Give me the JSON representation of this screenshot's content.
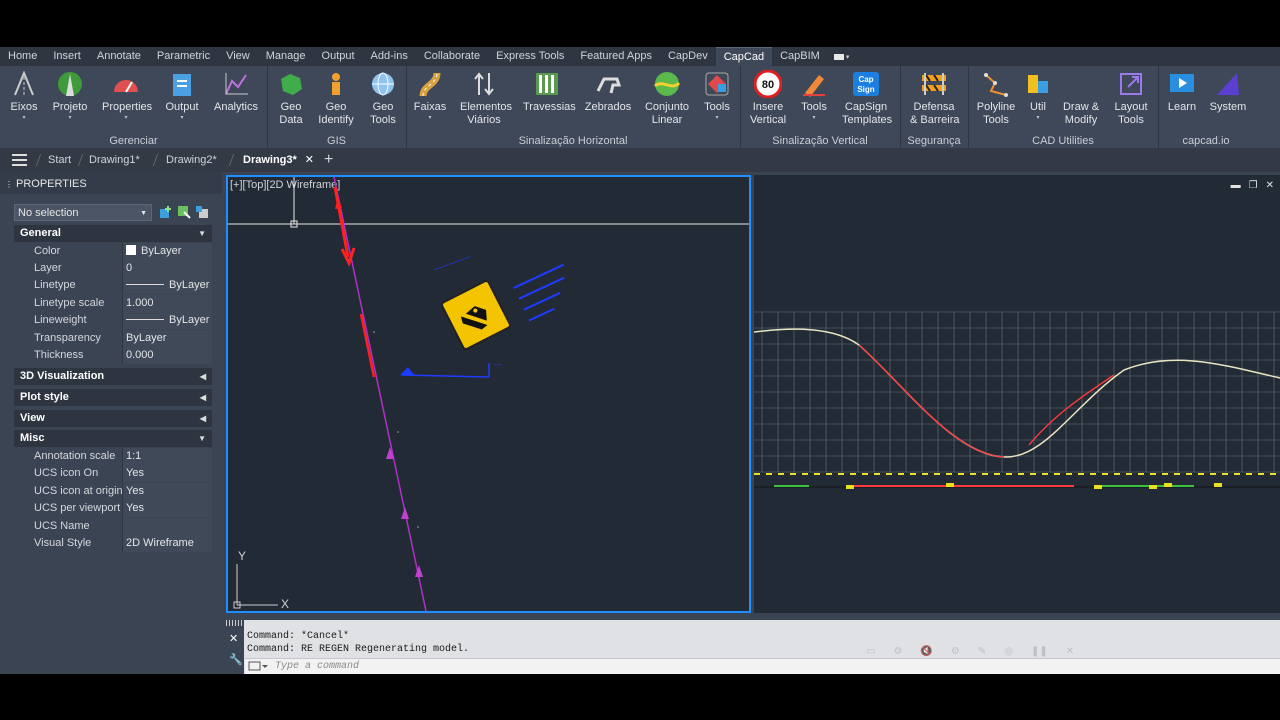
{
  "ribbon_tabs": [
    "Home",
    "Insert",
    "Annotate",
    "Parametric",
    "View",
    "Manage",
    "Output",
    "Add-ins",
    "Collaborate",
    "Express Tools",
    "Featured Apps",
    "CapDev",
    "CapCad",
    "CapBIM"
  ],
  "active_tab": "CapCad",
  "panels": {
    "gerenciar": {
      "title": "Gerenciar",
      "tools": [
        {
          "l1": "Eixos",
          "l2": ""
        },
        {
          "l1": "Projeto",
          "l2": ""
        },
        {
          "l1": "Properties",
          "l2": ""
        },
        {
          "l1": "Output",
          "l2": ""
        },
        {
          "l1": "Analytics",
          "l2": ""
        }
      ]
    },
    "gis": {
      "title": "GIS",
      "tools": [
        {
          "l1": "Geo",
          "l2": "Data"
        },
        {
          "l1": "Geo",
          "l2": "Identify"
        },
        {
          "l1": "Geo",
          "l2": "Tools"
        }
      ]
    },
    "sinal_h": {
      "title": "Sinalização Horizontal",
      "tools": [
        {
          "l1": "Faixas",
          "l2": ""
        },
        {
          "l1": "Elementos",
          "l2": "Viários"
        },
        {
          "l1": "Travessias",
          "l2": ""
        },
        {
          "l1": "Zebrados",
          "l2": ""
        },
        {
          "l1": "Conjunto",
          "l2": "Linear"
        },
        {
          "l1": "Tools",
          "l2": ""
        }
      ]
    },
    "sinal_v": {
      "title": "Sinalização Vertical",
      "tools": [
        {
          "l1": "Insere",
          "l2": "Vertical"
        },
        {
          "l1": "Tools",
          "l2": ""
        },
        {
          "l1": "CapSign",
          "l2": "Templates"
        }
      ],
      "speed": "80",
      "capsign": "Cap Sign"
    },
    "seguranca": {
      "title": "Segurança",
      "tools": [
        {
          "l1": "Defensa",
          "l2": "& Barreira"
        }
      ]
    },
    "cad": {
      "title": "CAD Utilities",
      "tools": [
        {
          "l1": "Polyline",
          "l2": "Tools"
        },
        {
          "l1": "Util",
          "l2": ""
        },
        {
          "l1": "Draw &",
          "l2": "Modify"
        },
        {
          "l1": "Layout",
          "l2": "Tools"
        }
      ]
    },
    "capcadio": {
      "title": "capcad.io",
      "tools": [
        {
          "l1": "Learn",
          "l2": ""
        },
        {
          "l1": "System",
          "l2": ""
        }
      ]
    }
  },
  "file_tabs": {
    "start": "Start",
    "d1": "Drawing1*",
    "d2": "Drawing2*",
    "d3": "Drawing3*",
    "close": "✕",
    "add": "+"
  },
  "properties": {
    "title": "PROPERTIES",
    "selection": "No selection",
    "groups": {
      "general": "General",
      "viz": "3D Visualization",
      "plot": "Plot style",
      "view": "View",
      "misc": "Misc"
    },
    "general_rows": [
      {
        "k": "Color",
        "v": "ByLayer"
      },
      {
        "k": "Layer",
        "v": "0"
      },
      {
        "k": "Linetype",
        "v": "ByLayer"
      },
      {
        "k": "Linetype scale",
        "v": "1.000"
      },
      {
        "k": "Lineweight",
        "v": "ByLayer"
      },
      {
        "k": "Transparency",
        "v": "ByLayer"
      },
      {
        "k": "Thickness",
        "v": "0.000"
      }
    ],
    "misc_rows": [
      {
        "k": "Annotation scale",
        "v": "1:1"
      },
      {
        "k": "UCS icon On",
        "v": "Yes"
      },
      {
        "k": "UCS icon at origin",
        "v": "Yes"
      },
      {
        "k": "UCS per viewport",
        "v": "Yes"
      },
      {
        "k": "UCS Name",
        "v": ""
      },
      {
        "k": "Visual Style",
        "v": "2D Wireframe"
      }
    ]
  },
  "viewport": {
    "label": "[+][Top][2D Wireframe]",
    "ucs_x": "X",
    "ucs_y": "Y"
  },
  "command": {
    "line1": "Command: *Cancel*",
    "line2": "Command: RE REGEN Regenerating model.",
    "placeholder": "Type a command"
  },
  "colors": {
    "accent": "#1f8fff",
    "road": "#b030c8",
    "highlight": "#ff2020",
    "annot": "#1e3cff",
    "sign": "#f5c400",
    "profile_red": "#ff3b3b",
    "profile_green": "#39c23a",
    "profile_yellow": "#e8e020"
  }
}
